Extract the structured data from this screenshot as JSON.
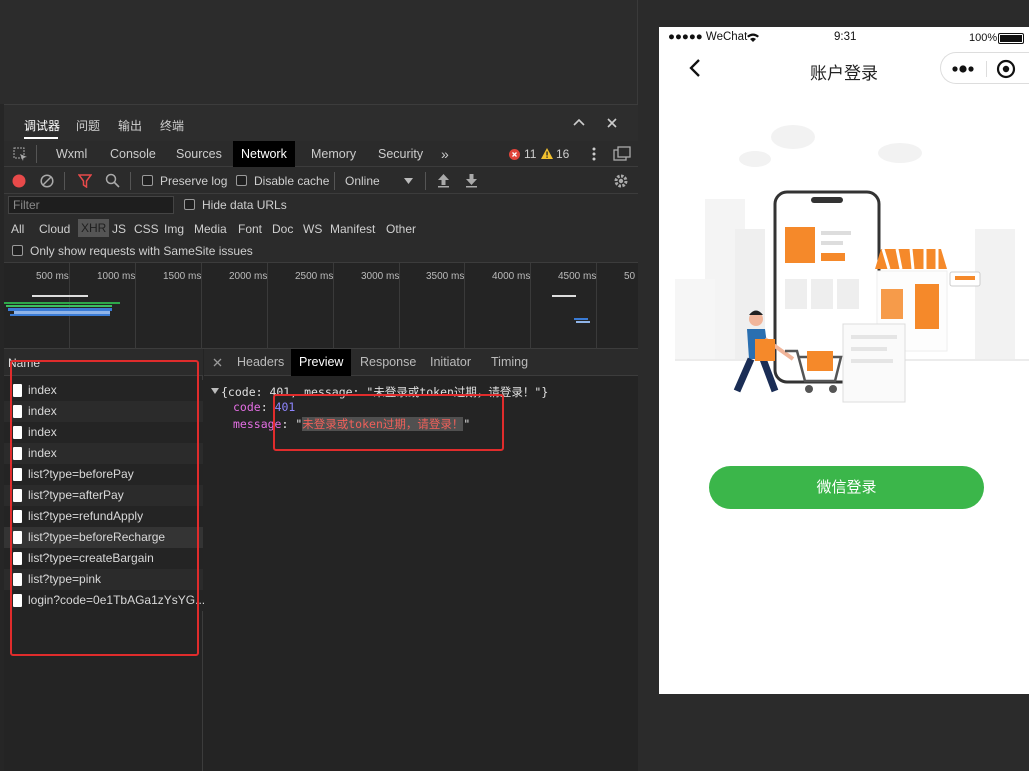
{
  "devtools": {
    "top_tabs": [
      "调试器",
      "问题",
      "输出",
      "终端"
    ],
    "panel_tabs": [
      "Wxml",
      "Console",
      "Sources",
      "Network",
      "Memory",
      "Security"
    ],
    "active_panel": "Network",
    "more_tabs_glyph": "»",
    "errors": "11",
    "warnings": "16",
    "preserve_log": "Preserve log",
    "disable_cache": "Disable cache",
    "throttle": "Online",
    "filter_placeholder": "Filter",
    "hide_data_urls": "Hide data URLs",
    "types": [
      "All",
      "Cloud",
      "XHR",
      "JS",
      "CSS",
      "Img",
      "Media",
      "Font",
      "Doc",
      "WS",
      "Manifest",
      "Other"
    ],
    "active_type": "XHR",
    "samesite": "Only show requests with SameSite issues",
    "timeline_ticks": [
      "500 ms",
      "1000 ms",
      "1500 ms",
      "2000 ms",
      "2500 ms",
      "3000 ms",
      "3500 ms",
      "4000 ms",
      "4500 ms",
      "50"
    ],
    "name_header": "Name",
    "requests": [
      "index",
      "index",
      "index",
      "index",
      "list?type=beforePay",
      "list?type=afterPay",
      "list?type=refundApply",
      "list?type=beforeRecharge",
      "list?type=createBargain",
      "list?type=pink",
      "login?code=0e1TbAGa1zYsYG..."
    ],
    "detail_tabs": [
      "Headers",
      "Preview",
      "Response",
      "Initiator",
      "Timing"
    ],
    "active_detail_tab": "Preview",
    "preview": {
      "summary": "{code: 401, message: \"未登录或token过期，请登录！\"}",
      "code_key": "code",
      "code_value": "401",
      "message_key": "message",
      "message_value": "未登录或token过期，请登录！"
    }
  },
  "phone": {
    "carrier": "●●●●● WeChat",
    "time": "9:31",
    "battery": "100%",
    "title": "账户登录",
    "login_button": "微信登录"
  },
  "colors": {
    "accent_green": "#3bb64a",
    "highlight_red": "#e02c2c",
    "illustration_orange": "#f5892a"
  }
}
